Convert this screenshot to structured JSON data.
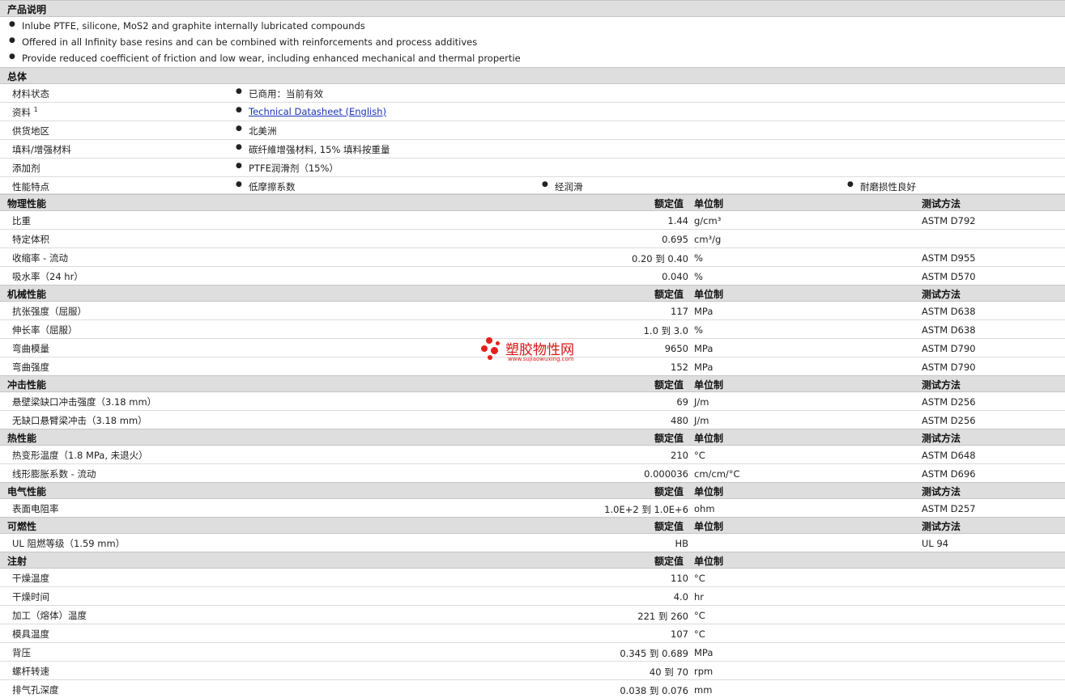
{
  "description": {
    "title": "产品说明",
    "items": [
      "Inlube PTFE, silicone, MoS2 and graphite internally lubricated compounds",
      "Offered in all Infinity base resins and can be combined with reinforcements and process additives",
      "Provide reduced coefficient of friction and low wear, including enhanced mechanical and thermal propertie"
    ]
  },
  "general": {
    "title": "总体",
    "status_label": "材料状态",
    "status_value": "已商用：当前有效",
    "doc_label": "资料",
    "doc_sup": "1",
    "doc_link": "Technical Datasheet (English)",
    "region_label": "供货地区",
    "region_value": "北美洲",
    "filler_label": "填料/增强材料",
    "filler_value": "碳纤維增强材料, 15% 填料按重量",
    "additive_label": "添加剂",
    "additive_value": "PTFE润滑剂（15%）",
    "features_label": "性能特点",
    "features": [
      "低摩擦系数",
      "经润滑",
      "耐磨损性良好"
    ]
  },
  "columns": {
    "rated": "额定值",
    "unit": "单位制",
    "method": "测试方法"
  },
  "physical": {
    "title": "物理性能",
    "rows": [
      {
        "name": "比重",
        "value": "1.44",
        "unit": "g/cm³",
        "method": "ASTM D792"
      },
      {
        "name": "特定体积",
        "value": "0.695",
        "unit": "cm³/g",
        "method": ""
      },
      {
        "name": "收缩率 - 流动",
        "value": "0.20 到  0.40",
        "unit": "%",
        "method": "ASTM D955"
      },
      {
        "name": "吸水率（24 hr）",
        "value": "0.040",
        "unit": "%",
        "method": "ASTM D570"
      }
    ]
  },
  "mechanical": {
    "title": "机械性能",
    "rows": [
      {
        "name": "抗张强度（屈服）",
        "value": "117",
        "unit": "MPa",
        "method": "ASTM D638"
      },
      {
        "name": "伸长率（屈服）",
        "value": "1.0 到  3.0",
        "unit": "%",
        "method": "ASTM D638"
      },
      {
        "name": "弯曲模量",
        "value": "9650",
        "unit": "MPa",
        "method": "ASTM D790"
      },
      {
        "name": "弯曲强度",
        "value": "152",
        "unit": "MPa",
        "method": "ASTM D790"
      }
    ]
  },
  "impact": {
    "title": "冲击性能",
    "rows": [
      {
        "name": "悬壁梁缺口冲击强度（3.18 mm）",
        "value": "69",
        "unit": "J/m",
        "method": "ASTM D256"
      },
      {
        "name": "无缺口悬臂梁冲击（3.18 mm）",
        "value": "480",
        "unit": "J/m",
        "method": "ASTM D256"
      }
    ]
  },
  "thermal": {
    "title": "热性能",
    "rows": [
      {
        "name": "热变形温度（1.8 MPa, 未退火）",
        "value": "210",
        "unit": "°C",
        "method": "ASTM D648"
      },
      {
        "name": "线形膨胀系数 - 流动",
        "value": "0.000036",
        "unit": "cm/cm/°C",
        "method": "ASTM D696"
      }
    ]
  },
  "electrical": {
    "title": "电气性能",
    "rows": [
      {
        "name": "表面电阻率",
        "value": "1.0E+2 到  1.0E+6",
        "unit": "ohm",
        "method": "ASTM D257"
      }
    ]
  },
  "flammability": {
    "title": "可燃性",
    "rows": [
      {
        "name": "UL 阻燃等级（1.59 mm）",
        "value": "HB",
        "unit": "",
        "method": "UL 94"
      }
    ]
  },
  "injection": {
    "title": "注射",
    "rows": [
      {
        "name": "干燥温度",
        "value": "110",
        "unit": "°C"
      },
      {
        "name": "干燥时间",
        "value": "4.0",
        "unit": "hr"
      },
      {
        "name": "加工（熔体）温度",
        "value": "221 到  260",
        "unit": "°C"
      },
      {
        "name": "模具温度",
        "value": "107",
        "unit": "°C"
      },
      {
        "name": "背压",
        "value": "0.345 到  0.689",
        "unit": "MPa"
      },
      {
        "name": "螺杆转速",
        "value": "40 到  70",
        "unit": "rpm"
      },
      {
        "name": "排气孔深度",
        "value": "0.038 到  0.076",
        "unit": "mm"
      }
    ]
  },
  "watermark": {
    "text": "塑胶物性网",
    "url": "www.sujiaowuxing.com"
  }
}
